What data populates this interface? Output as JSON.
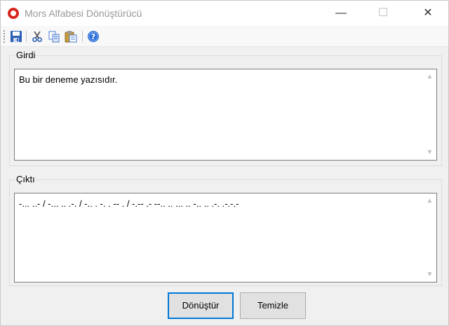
{
  "window": {
    "title": "Mors Alfabesi Dönüştürücü",
    "controls": {
      "minimize": "—",
      "maximize": "☐",
      "close": "✕"
    }
  },
  "toolbar": {
    "icons": [
      "save-icon",
      "cut-icon",
      "copy-icon",
      "paste-icon",
      "help-icon"
    ]
  },
  "input": {
    "label": "Girdi",
    "value": "Bu bir deneme yazısıdır."
  },
  "output": {
    "label": "Çıktı",
    "value": "-... ..- / -... .. .-. / -.. . -. . -- . / -.-- .- --.. .. ... .. -.. .. .-. .-.-.-"
  },
  "buttons": {
    "convert_label": "Dönüştür",
    "clear_label": "Temizle"
  },
  "colors": {
    "accent": "#0078d7",
    "app_icon": "#d9261c"
  }
}
